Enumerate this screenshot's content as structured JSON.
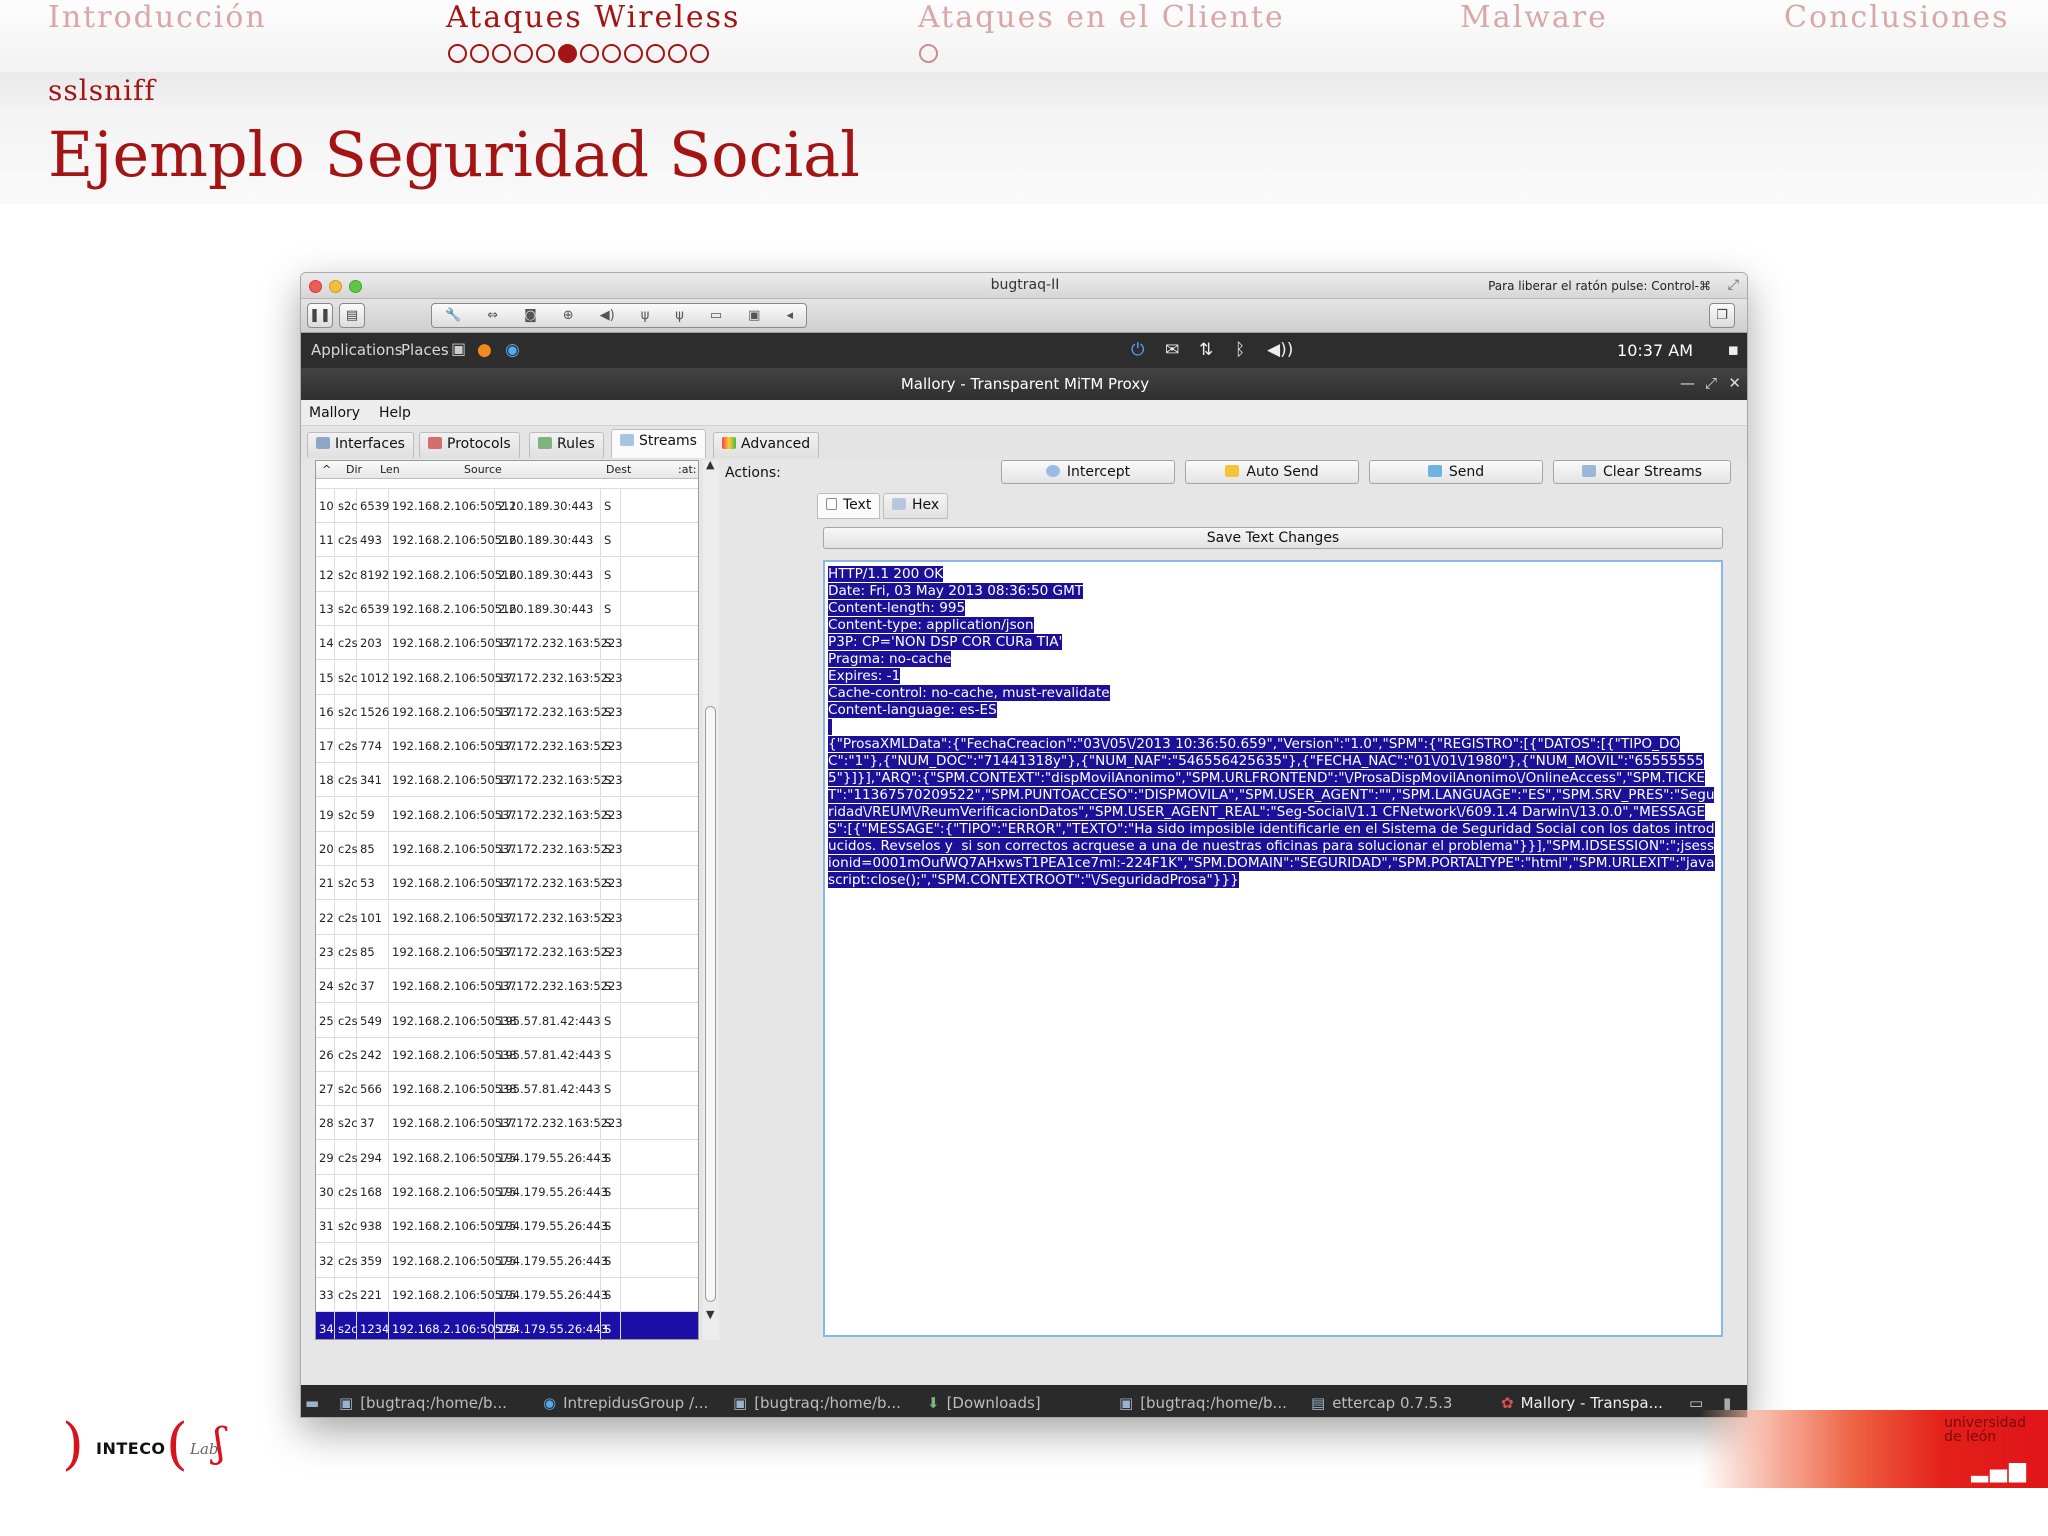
{
  "nav": {
    "sections": [
      {
        "label": "Introducción",
        "dots": 0,
        "filled": -1
      },
      {
        "label": "Ataques Wireless",
        "dots": 12,
        "filled": 5
      },
      {
        "label": "Ataques en el Cliente",
        "dots": 1,
        "filled": -1
      },
      {
        "label": "Malware",
        "dots": 0,
        "filled": -1
      },
      {
        "label": "Conclusiones",
        "dots": 0,
        "filled": -1
      }
    ],
    "active_index": 1
  },
  "subsection": "sslsniff",
  "slide_title": "Ejemplo Seguridad Social",
  "vm": {
    "title": "bugtraq-II",
    "hint": "Para liberar el ratón pulse: Control-⌘",
    "tools": [
      "wrench-icon",
      "arrows-icon",
      "disk-icon",
      "lock-icon",
      "speaker-icon",
      "usb-icon",
      "usb-icon",
      "folder-icon",
      "window-icon"
    ]
  },
  "gnome": {
    "applications": "Applications",
    "places": "Places",
    "clock": "10:37 AM"
  },
  "mallory": {
    "title": "Mallory - Transparent MiTM Proxy",
    "menu": [
      "Mallory",
      "Help"
    ],
    "tabs": [
      "Interfaces",
      "Protocols",
      "Rules",
      "Streams",
      "Advanced"
    ],
    "selected_tab": "Streams",
    "columns": [
      "Dir",
      "Len",
      "Source",
      "Dest",
      ":at:"
    ],
    "rows": [
      [
        "10",
        "s2c",
        "6539",
        "192.168.2.106:50511",
        "2.20.189.30:443",
        "S"
      ],
      [
        "11",
        "c2s",
        "493",
        "192.168.2.106:50516",
        "2.20.189.30:443",
        "S"
      ],
      [
        "12",
        "s2c",
        "8192",
        "192.168.2.106:50516",
        "2.20.189.30:443",
        "S"
      ],
      [
        "13",
        "s2c",
        "6539",
        "192.168.2.106:50516",
        "2.20.189.30:443",
        "S"
      ],
      [
        "14",
        "c2s",
        "203",
        "192.168.2.106:50537",
        "17.172.232.163:5223",
        "S"
      ],
      [
        "15",
        "s2c",
        "1012",
        "192.168.2.106:50537",
        "17.172.232.163:5223",
        "S"
      ],
      [
        "16",
        "s2c",
        "1526",
        "192.168.2.106:50537",
        "17.172.232.163:5223",
        "S"
      ],
      [
        "17",
        "c2s",
        "774",
        "192.168.2.106:50537",
        "17.172.232.163:5223",
        "S"
      ],
      [
        "18",
        "c2s",
        "341",
        "192.168.2.106:50537",
        "17.172.232.163:5223",
        "S"
      ],
      [
        "19",
        "s2c",
        "59",
        "192.168.2.106:50537",
        "17.172.232.163:5223",
        "S"
      ],
      [
        "20",
        "c2s",
        "85",
        "192.168.2.106:50537",
        "17.172.232.163:5223",
        "S"
      ],
      [
        "21",
        "s2c",
        "53",
        "192.168.2.106:50537",
        "17.172.232.163:5223",
        "S"
      ],
      [
        "22",
        "c2s",
        "101",
        "192.168.2.106:50537",
        "17.172.232.163:5223",
        "S"
      ],
      [
        "23",
        "c2s",
        "85",
        "192.168.2.106:50537",
        "17.172.232.163:5223",
        "S"
      ],
      [
        "24",
        "s2c",
        "37",
        "192.168.2.106:50537",
        "17.172.232.163:5223",
        "S"
      ],
      [
        "25",
        "c2s",
        "549",
        "192.168.2.106:50538",
        "195.57.81.42:443",
        "S"
      ],
      [
        "26",
        "c2s",
        "242",
        "192.168.2.106:50538",
        "195.57.81.42:443",
        "S"
      ],
      [
        "27",
        "s2c",
        "566",
        "192.168.2.106:50538",
        "195.57.81.42:443",
        "S"
      ],
      [
        "28",
        "s2c",
        "37",
        "192.168.2.106:50537",
        "17.172.232.163:5223",
        "S"
      ],
      [
        "29",
        "c2s",
        "294",
        "192.168.2.106:50575",
        "194.179.55.26:443",
        "S"
      ],
      [
        "30",
        "c2s",
        "168",
        "192.168.2.106:50575",
        "194.179.55.26:443",
        "S"
      ],
      [
        "31",
        "s2c",
        "938",
        "192.168.2.106:50575",
        "194.179.55.26:443",
        "S"
      ],
      [
        "32",
        "c2s",
        "359",
        "192.168.2.106:50575",
        "194.179.55.26:443",
        "S"
      ],
      [
        "33",
        "c2s",
        "221",
        "192.168.2.106:50575",
        "194.179.55.26:443",
        "S"
      ],
      [
        "34",
        "s2c",
        "1234",
        "192.168.2.106:50575",
        "194.179.55.26:443",
        "S"
      ]
    ],
    "selected_row": "34",
    "actions_label": "Actions:",
    "actions": [
      "Intercept",
      "Auto Send",
      "Send",
      "Clear Streams"
    ],
    "subtabs": [
      "Text",
      "Hex"
    ],
    "save_label": "Save Text Changes",
    "stream_text": [
      "HTTP/1.1 200 OK",
      "Date: Fri, 03 May 2013 08:36:50 GMT",
      "Content-length: 995",
      "Content-type: application/json",
      "P3P: CP='NON DSP COR CURa TIA'",
      "Pragma: no-cache",
      "Expires: -1",
      "Cache-control: no-cache, must-revalidate",
      "Content-language: es-ES",
      "",
      "{\"ProsaXMLData\":{\"FechaCreacion\":\"03\\/05\\/2013 10:36:50.659\",\"Version\":\"1.0\",\"SPM\":{\"REGISTRO\":[{\"DATOS\":[{\"TIPO_DOC\":\"1\"},{\"NUM_DOC\":\"71441318y\"},{\"NUM_NAF\":\"546556425635\"},{\"FECHA_NAC\":\"01\\/01\\/1980\"},{\"NUM_MOVIL\":\"655555555\"}]}],\"ARQ\":{\"SPM.CONTEXT\":\"dispMovilAnonimo\",\"SPM.URLFRONTEND\":\"\\/ProsaDispMovilAnonimo\\/OnlineAccess\",\"SPM.TICKET\":\"11367570209522\",\"SPM.PUNTOACCESO\":\"DISPMOVILA\",\"SPM.USER_AGENT\":\"\",\"SPM.LANGUAGE\":\"ES\",\"SPM.SRV_PRES\":\"Seguridad\\/REUM\\/ReumVerificacionDatos\",\"SPM.USER_AGENT_REAL\":\"Seg-Social\\/1.1 CFNetwork\\/609.1.4 Darwin\\/13.0.0\",\"MESSAGES\":[{\"MESSAGE\":{\"TIPO\":\"ERROR\",\"TEXTO\":\"Ha sido imposible identificarle en el Sistema de Seguridad Social con los datos introducidos. Revselos y  si son correctos acrquese a una de nuestras oficinas para solucionar el problema\"}}],\"SPM.IDSESSION\":\";jsessionid=0001mOufWQ7AHxwsT1PEA1ce7ml:-224F1K\",\"SPM.DOMAIN\":\"SEGURIDAD\",\"SPM.PORTALTYPE\":\"html\",\"SPM.URLEXIT\":\"javascript:close();\",\"SPM.CONTEXTROOT\":\"\\/SeguridadProsa\"}}}"
    ]
  },
  "taskbar": [
    "[bugtraq:/home/b...",
    "IntrepidusGroup /...",
    "[bugtraq:/home/b...",
    "[Downloads]",
    "[bugtraq:/home/b...",
    "ettercap 0.7.5.3",
    "Mallory - Transpa..."
  ],
  "logos": {
    "inteco": "INTECO",
    "lab": "Lab",
    "uleon_line1": "universidad",
    "uleon_line2": "de león"
  },
  "colors": {
    "beamer_red": "#a31515",
    "selection_blue": "#1b0fa8"
  }
}
